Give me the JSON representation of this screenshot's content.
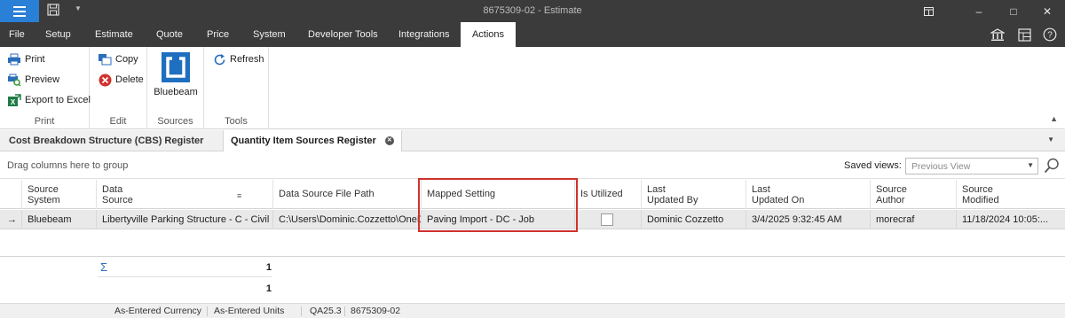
{
  "window": {
    "title": "8675309-02 - Estimate",
    "controls": {
      "minimize": "–",
      "maximize": "□",
      "close": "✕"
    },
    "colors": {
      "titlebar": "#3b3b3b",
      "accent": "#2a7fd6",
      "highlight": "#d0312d"
    }
  },
  "menu": {
    "items": [
      "File",
      "Setup",
      "Estimate",
      "Quote",
      "Price",
      "System",
      "Developer Tools",
      "Integrations",
      "Actions"
    ],
    "active": "Actions",
    "right_icons": [
      "bank-icon",
      "layout-icon",
      "help-icon"
    ]
  },
  "ribbon": {
    "groups": {
      "print": {
        "label": "Print",
        "buttons": [
          "Print",
          "Preview",
          "Export to Excel"
        ]
      },
      "edit": {
        "label": "Edit",
        "buttons": [
          "Copy",
          "Delete"
        ]
      },
      "sources": {
        "label": "Sources",
        "buttons": [
          "Bluebeam"
        ]
      },
      "tools": {
        "label": "Tools",
        "buttons": [
          "Refresh"
        ]
      }
    }
  },
  "doc_tabs": {
    "tabs": [
      "Cost Breakdown Structure (CBS) Register",
      "Quantity Item Sources Register"
    ],
    "active": "Quantity Item Sources Register"
  },
  "group_panel": {
    "hint": "Drag columns here to group",
    "saved_views_label": "Saved views:",
    "saved_views_value": "Previous View"
  },
  "grid": {
    "headers": [
      [
        "Source",
        "System"
      ],
      [
        "Data",
        "Source"
      ],
      [
        "Data Source File Path"
      ],
      [
        "Mapped Setting"
      ],
      [
        "Is Utilized"
      ],
      [
        "Last",
        "Updated By"
      ],
      [
        "Last",
        "Updated On"
      ],
      [
        "Source",
        "Author"
      ],
      [
        "Source",
        "Modified"
      ]
    ],
    "row_indicator": "→",
    "rows": [
      {
        "source_system": "Bluebeam",
        "data_source": "Libertyville Parking Structure - C - Civil - ...",
        "file_path": "C:\\Users\\Dominic.Cozzetto\\OneD...",
        "mapped_setting": "Paving Import - DC - Job",
        "is_utilized": false,
        "last_updated_by": "Dominic Cozzetto",
        "last_updated_on": "3/4/2025 9:32:45 AM",
        "source_author": "morecraf",
        "source_modified": "11/18/2024 10:05:..."
      }
    ],
    "summary": {
      "symbol": "Σ",
      "count": "1",
      "total": "1"
    }
  },
  "status_bar": {
    "items": [
      "As-Entered Currency",
      "As-Entered Units",
      "QA25.3",
      "8675309-02"
    ]
  }
}
